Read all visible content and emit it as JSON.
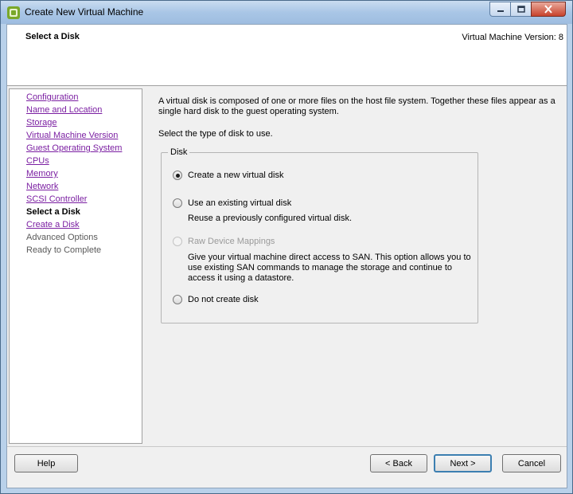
{
  "window": {
    "title": "Create New Virtual Machine",
    "icon": "vmware-vsphere-icon",
    "controls": [
      "minimize-icon",
      "maximize-icon",
      "close-icon"
    ]
  },
  "header": {
    "title": "Select a Disk",
    "version": "Virtual Machine Version: 8"
  },
  "nav": {
    "items": [
      {
        "label": "Configuration",
        "state": "link"
      },
      {
        "label": "Name and Location",
        "state": "link"
      },
      {
        "label": "Storage",
        "state": "link"
      },
      {
        "label": "Virtual Machine Version",
        "state": "link"
      },
      {
        "label": "Guest Operating System",
        "state": "link"
      },
      {
        "label": "CPUs",
        "state": "link"
      },
      {
        "label": "Memory",
        "state": "link"
      },
      {
        "label": "Network",
        "state": "link"
      },
      {
        "label": "SCSI Controller",
        "state": "link"
      },
      {
        "label": "Select a Disk",
        "state": "current"
      },
      {
        "label": "Create a Disk",
        "state": "link"
      },
      {
        "label": "Advanced Options",
        "state": "future"
      },
      {
        "label": "Ready to Complete",
        "state": "future"
      }
    ]
  },
  "content": {
    "intro": "A virtual disk is composed of one or more files on the host file system. Together these files appear as a single hard disk to the guest operating system.",
    "prompt": "Select the type of disk to use.",
    "group_label": "Disk",
    "options": [
      {
        "label": "Create a new virtual disk",
        "selected": true,
        "disabled": false,
        "description": ""
      },
      {
        "label": "Use an existing virtual disk",
        "selected": false,
        "disabled": false,
        "description": "Reuse a previously configured virtual disk."
      },
      {
        "label": "Raw Device Mappings",
        "selected": false,
        "disabled": true,
        "description": "Give your virtual machine direct access to SAN. This option allows you to use existing SAN commands to manage the storage and continue to access it using a datastore."
      },
      {
        "label": "Do not create disk",
        "selected": false,
        "disabled": false,
        "description": ""
      }
    ]
  },
  "footer": {
    "help_label": "Help",
    "back_label": "< Back",
    "next_label": "Next >",
    "cancel_label": "Cancel"
  }
}
